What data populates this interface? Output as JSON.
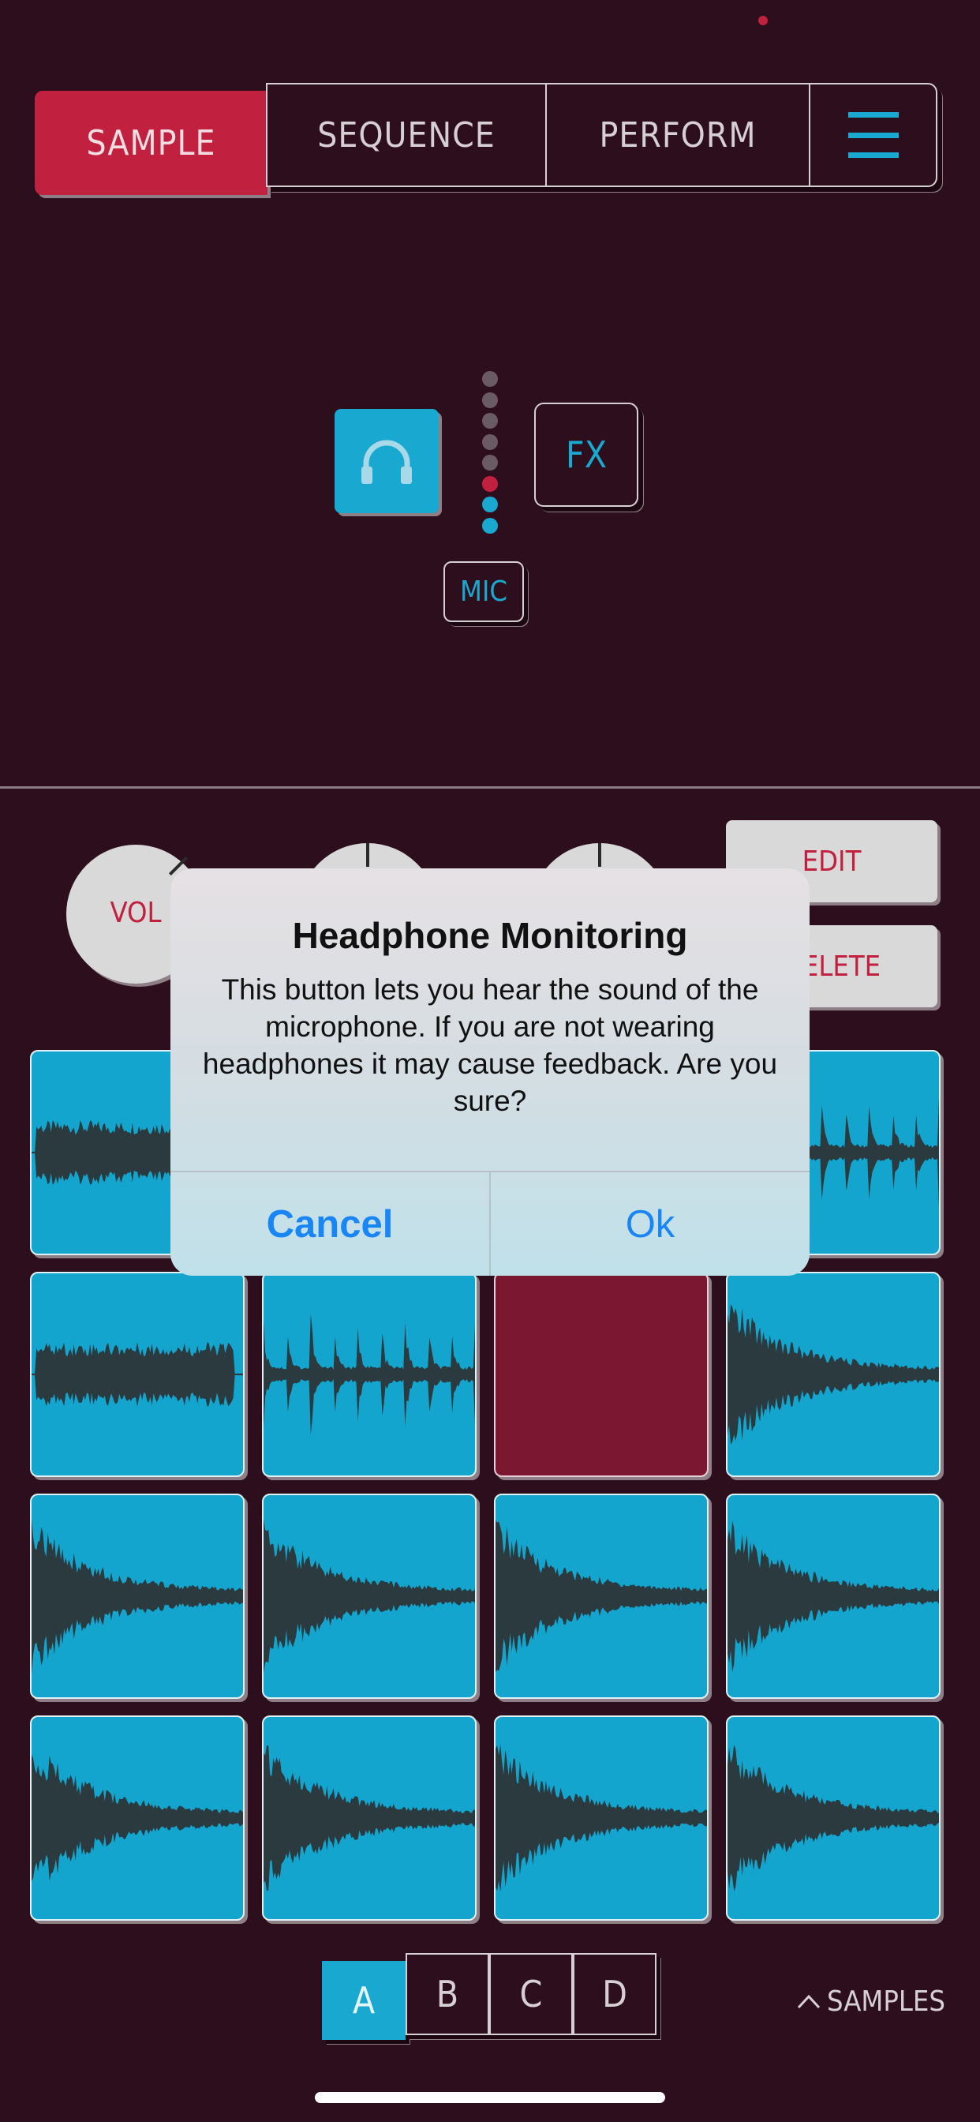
{
  "tabs": {
    "sample": "SAMPLE",
    "sequence": "SEQUENCE",
    "perform": "PERFORM",
    "menu_icon": "hamburger-menu-icon"
  },
  "monitor": {
    "headphone_icon": "headphones-icon",
    "fx_label": "FX",
    "mic_label": "MIC",
    "meter_levels": [
      "off",
      "off",
      "off",
      "off",
      "off",
      "red",
      "blue",
      "blue"
    ]
  },
  "controls": {
    "vol_label": "VOL",
    "edit_label": "EDIT",
    "delete_label": "DELETE"
  },
  "pads": [
    {
      "state": "filled",
      "waveform": "noise-long"
    },
    {
      "state": "filled",
      "waveform": "noise-long"
    },
    {
      "state": "filled",
      "waveform": "noise-long"
    },
    {
      "state": "filled",
      "waveform": "spikes"
    },
    {
      "state": "filled",
      "waveform": "noise-long"
    },
    {
      "state": "filled",
      "waveform": "spikes"
    },
    {
      "state": "empty",
      "waveform": "none"
    },
    {
      "state": "filled",
      "waveform": "decay"
    },
    {
      "state": "filled",
      "waveform": "decay"
    },
    {
      "state": "filled",
      "waveform": "decay"
    },
    {
      "state": "filled",
      "waveform": "decay"
    },
    {
      "state": "filled",
      "waveform": "decay"
    },
    {
      "state": "filled",
      "waveform": "decay"
    },
    {
      "state": "filled",
      "waveform": "decay"
    },
    {
      "state": "filled",
      "waveform": "decay"
    },
    {
      "state": "filled",
      "waveform": "decay"
    }
  ],
  "banks": [
    "A",
    "B",
    "C",
    "D"
  ],
  "active_bank": "A",
  "samples_toggle": "SAMPLES",
  "alert": {
    "title": "Headphone Monitoring",
    "message": "This button lets you hear the sound of the microphone. If you are not wearing headphones it may cause feedback. Are you sure?",
    "cancel": "Cancel",
    "ok": "Ok"
  },
  "colors": {
    "background": "#2d0e1d",
    "accent_red": "#c2203f",
    "accent_blue": "#19a8cf",
    "alert_button_blue": "#1a86f5"
  }
}
